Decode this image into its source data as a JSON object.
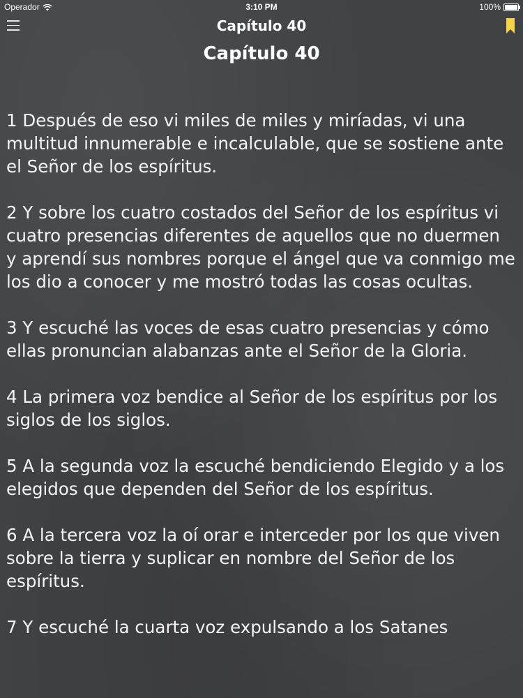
{
  "status_bar": {
    "carrier": "Operador",
    "time": "3:10 PM",
    "battery": "100%"
  },
  "nav": {
    "title": "Capítulo 40",
    "menu_icon": "hamburger-menu-icon",
    "bookmark_icon": "bookmark-icon",
    "bookmark_color": "#f5d547"
  },
  "chapter": {
    "heading": "Capítulo 40",
    "verses": [
      "1 Después de eso vi miles de miles y miríadas, vi una multitud innumerable e incalculable, que se sostiene ante el Señor de los espíritus.",
      "2 Y sobre los cuatro costados del Señor de los espíritus vi cuatro presencias diferentes de aquellos que no duermen y aprendí sus nombres porque el ángel que va conmigo me los dio a conocer y me mostró todas las cosas ocultas.",
      "3 Y escuché las voces de esas cuatro presencias y cómo ellas pronuncian alabanzas ante el Señor de la Gloria.",
      "4 La primera voz bendice al Señor de los espíritus por los siglos de los siglos.",
      "5 A la segunda voz la escuché bendiciendo Elegido y a los elegidos que dependen del Señor de los espíritus.",
      "6 A la tercera voz la oí orar e interceder por los que viven sobre la tierra y suplicar en nombre del Señor de los espíritus.",
      "7 Y escuché la cuarta voz expulsando a los Satanes"
    ]
  }
}
